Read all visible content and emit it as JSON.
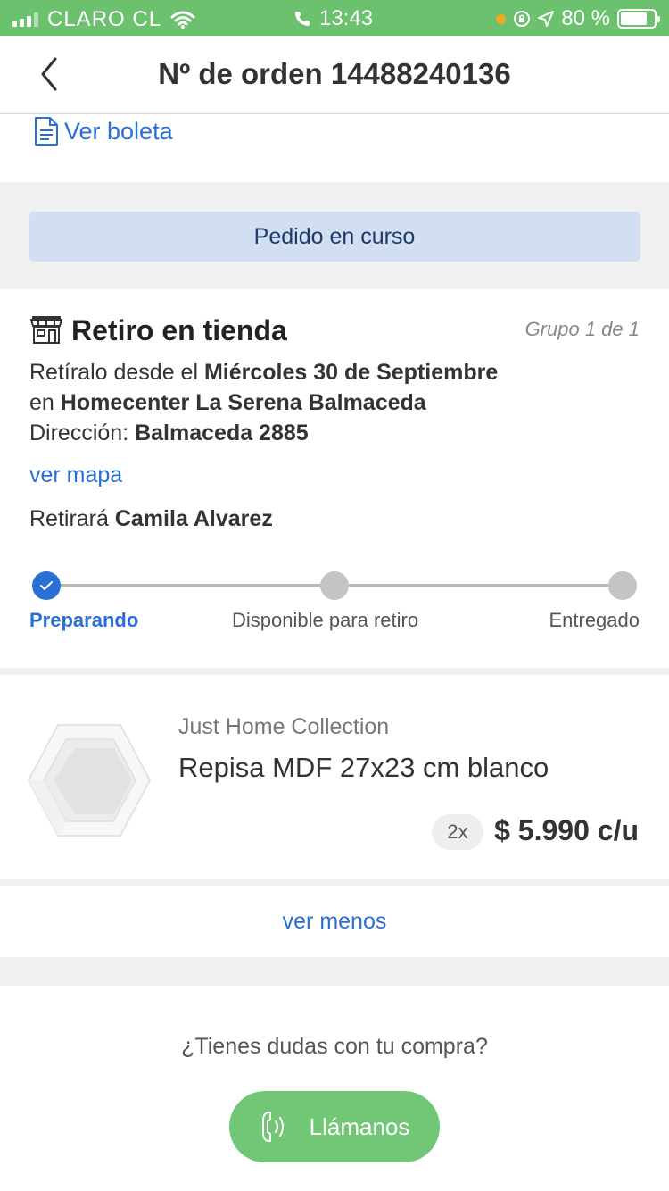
{
  "status_bar": {
    "carrier": "CLARO CL",
    "time": "13:43",
    "battery": "80 %",
    "battery_level": 0.8
  },
  "header": {
    "title": "Nº de orden 14488240136"
  },
  "boleta": {
    "label": "Ver boleta"
  },
  "order_status": {
    "label": "Pedido en curso"
  },
  "pickup": {
    "title": "Retiro en tienda",
    "group": "Grupo  1 de 1",
    "line1_prefix": "Retíralo desde el ",
    "line1_date": "Miércoles 30 de Septiembre",
    "line2_prefix": "en ",
    "line2_store": "Homecenter La Serena Balmaceda",
    "line3_prefix": "Dirección: ",
    "line3_address": "Balmaceda 2885",
    "map_link": "ver mapa",
    "retirara_prefix": "Retirará ",
    "retirara_name": "Camila  Alvarez"
  },
  "tracker": {
    "steps": [
      {
        "label": "Preparando",
        "done": true
      },
      {
        "label": "Disponible para retiro",
        "done": false
      },
      {
        "label": "Entregado",
        "done": false
      }
    ]
  },
  "product": {
    "brand": "Just Home Collection",
    "name": "Repisa MDF 27x23 cm blanco",
    "quantity": "2x",
    "price": "$ 5.990 c/u"
  },
  "toggle": {
    "label": "ver menos"
  },
  "help": {
    "question": "¿Tienes dudas con tu compra?",
    "call_label": "Llámanos"
  },
  "colors": {
    "status_bar": "#6cc16f",
    "link": "#2a6fd3",
    "status_pill": "#d2dff2",
    "call_button": "#72c777"
  }
}
